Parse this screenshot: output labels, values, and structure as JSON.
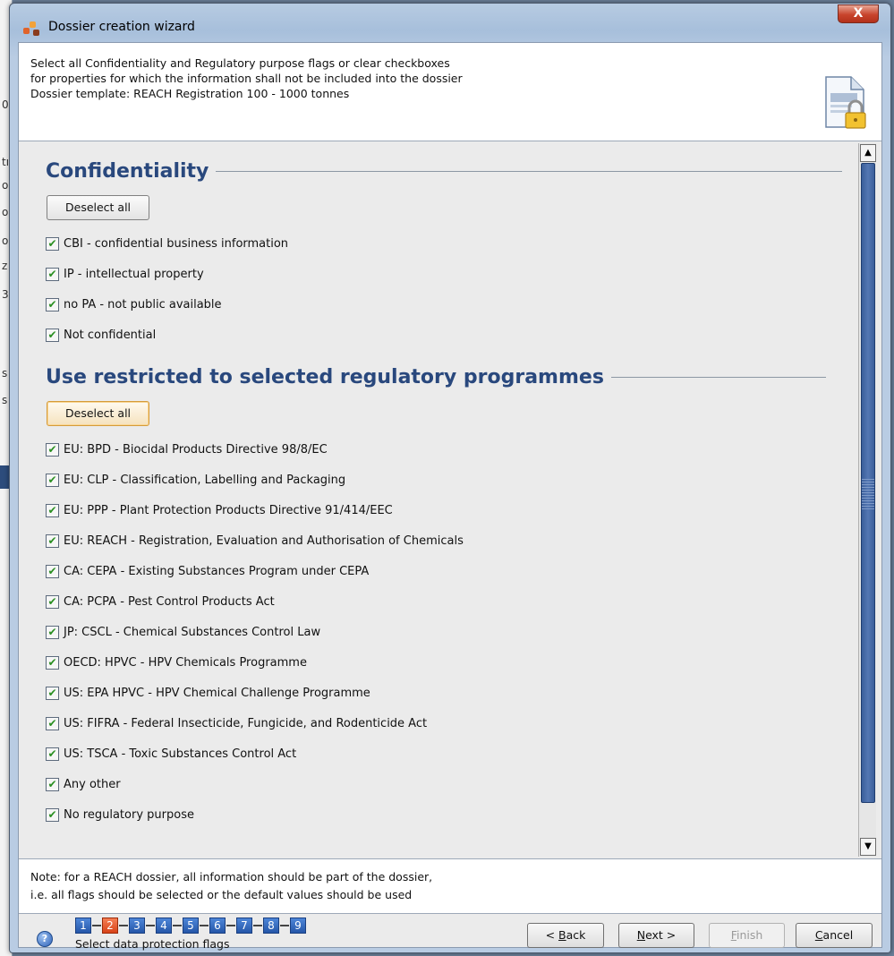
{
  "window": {
    "title": "Dossier creation wizard",
    "close_label": "X"
  },
  "header": {
    "lines": [
      "Select all Confidentiality and Regulatory purpose flags or clear checkboxes",
      "for properties for which the information shall not be included into the dossier",
      "Dossier template: REACH Registration 100 - 1000 tonnes"
    ],
    "icon": "document-lock-icon"
  },
  "confidentiality": {
    "title": "Confidentiality",
    "deselect_label": "Deselect all",
    "items": [
      {
        "label": "CBI - confidential business information",
        "checked": true
      },
      {
        "label": "IP - intellectual property",
        "checked": true
      },
      {
        "label": "no PA - not public available",
        "checked": true
      },
      {
        "label": "Not confidential",
        "checked": true
      }
    ]
  },
  "regulatory": {
    "title": "Use restricted to selected regulatory programmes",
    "deselect_label": "Deselect all",
    "items": [
      {
        "label": "EU: BPD - Biocidal Products Directive 98/8/EC",
        "checked": true
      },
      {
        "label": "EU: CLP - Classification, Labelling and Packaging",
        "checked": true
      },
      {
        "label": "EU: PPP - Plant Protection Products Directive 91/414/EEC",
        "checked": true
      },
      {
        "label": "EU: REACH - Registration, Evaluation and Authorisation of Chemicals",
        "checked": true
      },
      {
        "label": "CA: CEPA - Existing Substances Program under CEPA",
        "checked": true
      },
      {
        "label": "CA: PCPA - Pest Control Products Act",
        "checked": true
      },
      {
        "label": "JP: CSCL - Chemical Substances Control Law",
        "checked": true
      },
      {
        "label": "OECD: HPVC - HPV Chemicals Programme",
        "checked": true
      },
      {
        "label": "US: EPA HPVC - HPV Chemical Challenge Programme",
        "checked": true
      },
      {
        "label": "US: FIFRA - Federal Insecticide, Fungicide, and Rodenticide Act",
        "checked": true
      },
      {
        "label": "US: TSCA - Toxic Substances Control Act",
        "checked": true
      },
      {
        "label": "Any other",
        "checked": true
      },
      {
        "label": "No regulatory purpose",
        "checked": true
      }
    ]
  },
  "note": {
    "lines": [
      "Note: for a REACH dossier, all information should be part of the dossier,",
      "i.e. all flags should be selected or the default values should be used"
    ]
  },
  "wizard": {
    "steps": [
      "1",
      "2",
      "3",
      "4",
      "5",
      "6",
      "7",
      "8",
      "9"
    ],
    "current_step": 2,
    "step_label": "Select data protection flags",
    "back_label_accel": "< ",
    "back_label_key": "B",
    "back_label_rest": "ack",
    "next_label_key": "N",
    "next_label_rest": "ext >",
    "finish_label_key": "F",
    "finish_label_rest": "inish",
    "cancel_label_key": "C",
    "cancel_label_rest": "ancel",
    "finish_enabled": false
  },
  "colors": {
    "section_title": "#29487d",
    "check": "#2a8f22",
    "current_step": "#d84318",
    "step": "#2556a8"
  }
}
